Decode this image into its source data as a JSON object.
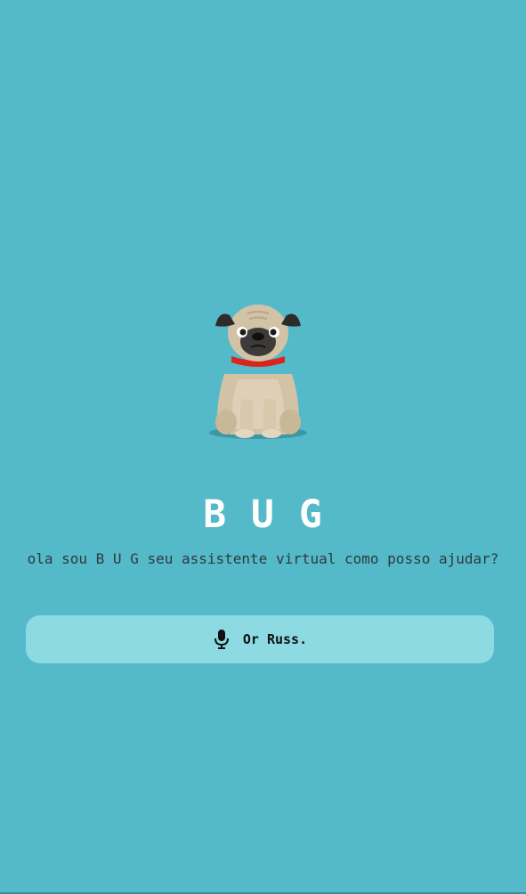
{
  "app": {
    "title": "B U G",
    "subtitle": "ola sou B U G seu assistente virtual como posso ajudar?"
  },
  "mascot": {
    "icon": "pug-dog-icon"
  },
  "voice_button": {
    "icon": "microphone-icon",
    "label": "Or Russ."
  },
  "colors": {
    "background": "#54b9c9",
    "button": "#8ddae3",
    "title": "#ffffff",
    "subtitle": "#2f3a3d",
    "collar": "#d8261d"
  }
}
